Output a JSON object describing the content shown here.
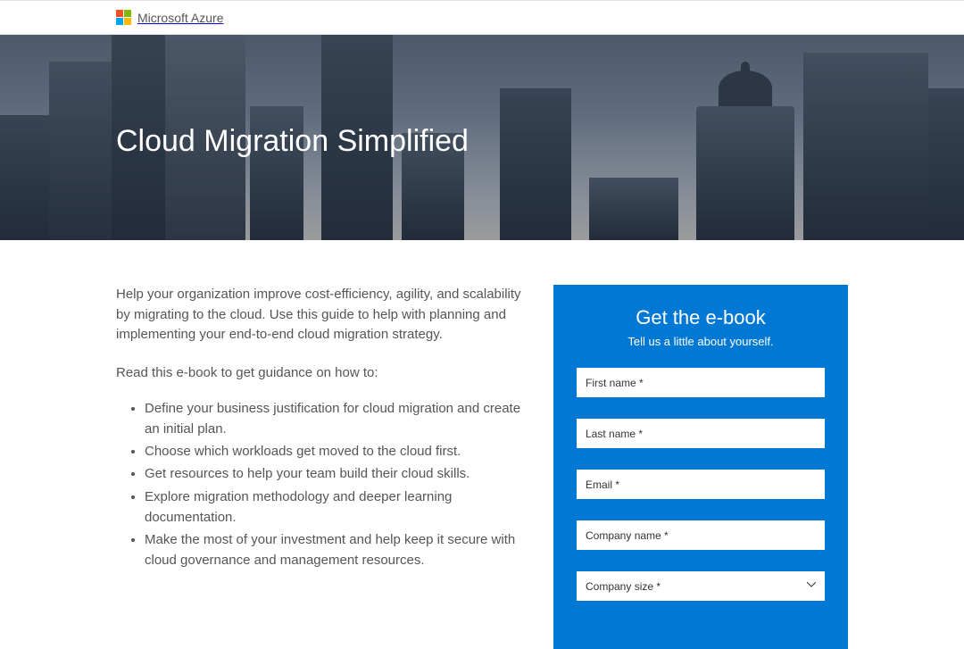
{
  "header": {
    "brand": "Microsoft Azure"
  },
  "hero": {
    "title": "Cloud Migration Simplified"
  },
  "content": {
    "intro": "Help your organization improve cost-efficiency, agility, and scalability by migrating to the cloud. Use this guide to help with planning and implementing your end-to-end cloud migration strategy.",
    "lead": "Read this e-book to get guidance on how to:",
    "bullets": [
      "Define your business justification for cloud migration and create an initial plan.",
      "Choose which workloads get moved to the cloud first.",
      "Get resources to help your team build their cloud skills.",
      "Explore migration methodology and deeper learning documentation.",
      "Make the most of your investment and help keep it secure with cloud governance and management resources."
    ]
  },
  "form": {
    "title": "Get the e-book",
    "subtitle": "Tell us a little about yourself.",
    "fields": {
      "first_name": "First name *",
      "last_name": "Last name *",
      "email": "Email *",
      "company_name": "Company name *",
      "company_size": "Company size *"
    }
  }
}
